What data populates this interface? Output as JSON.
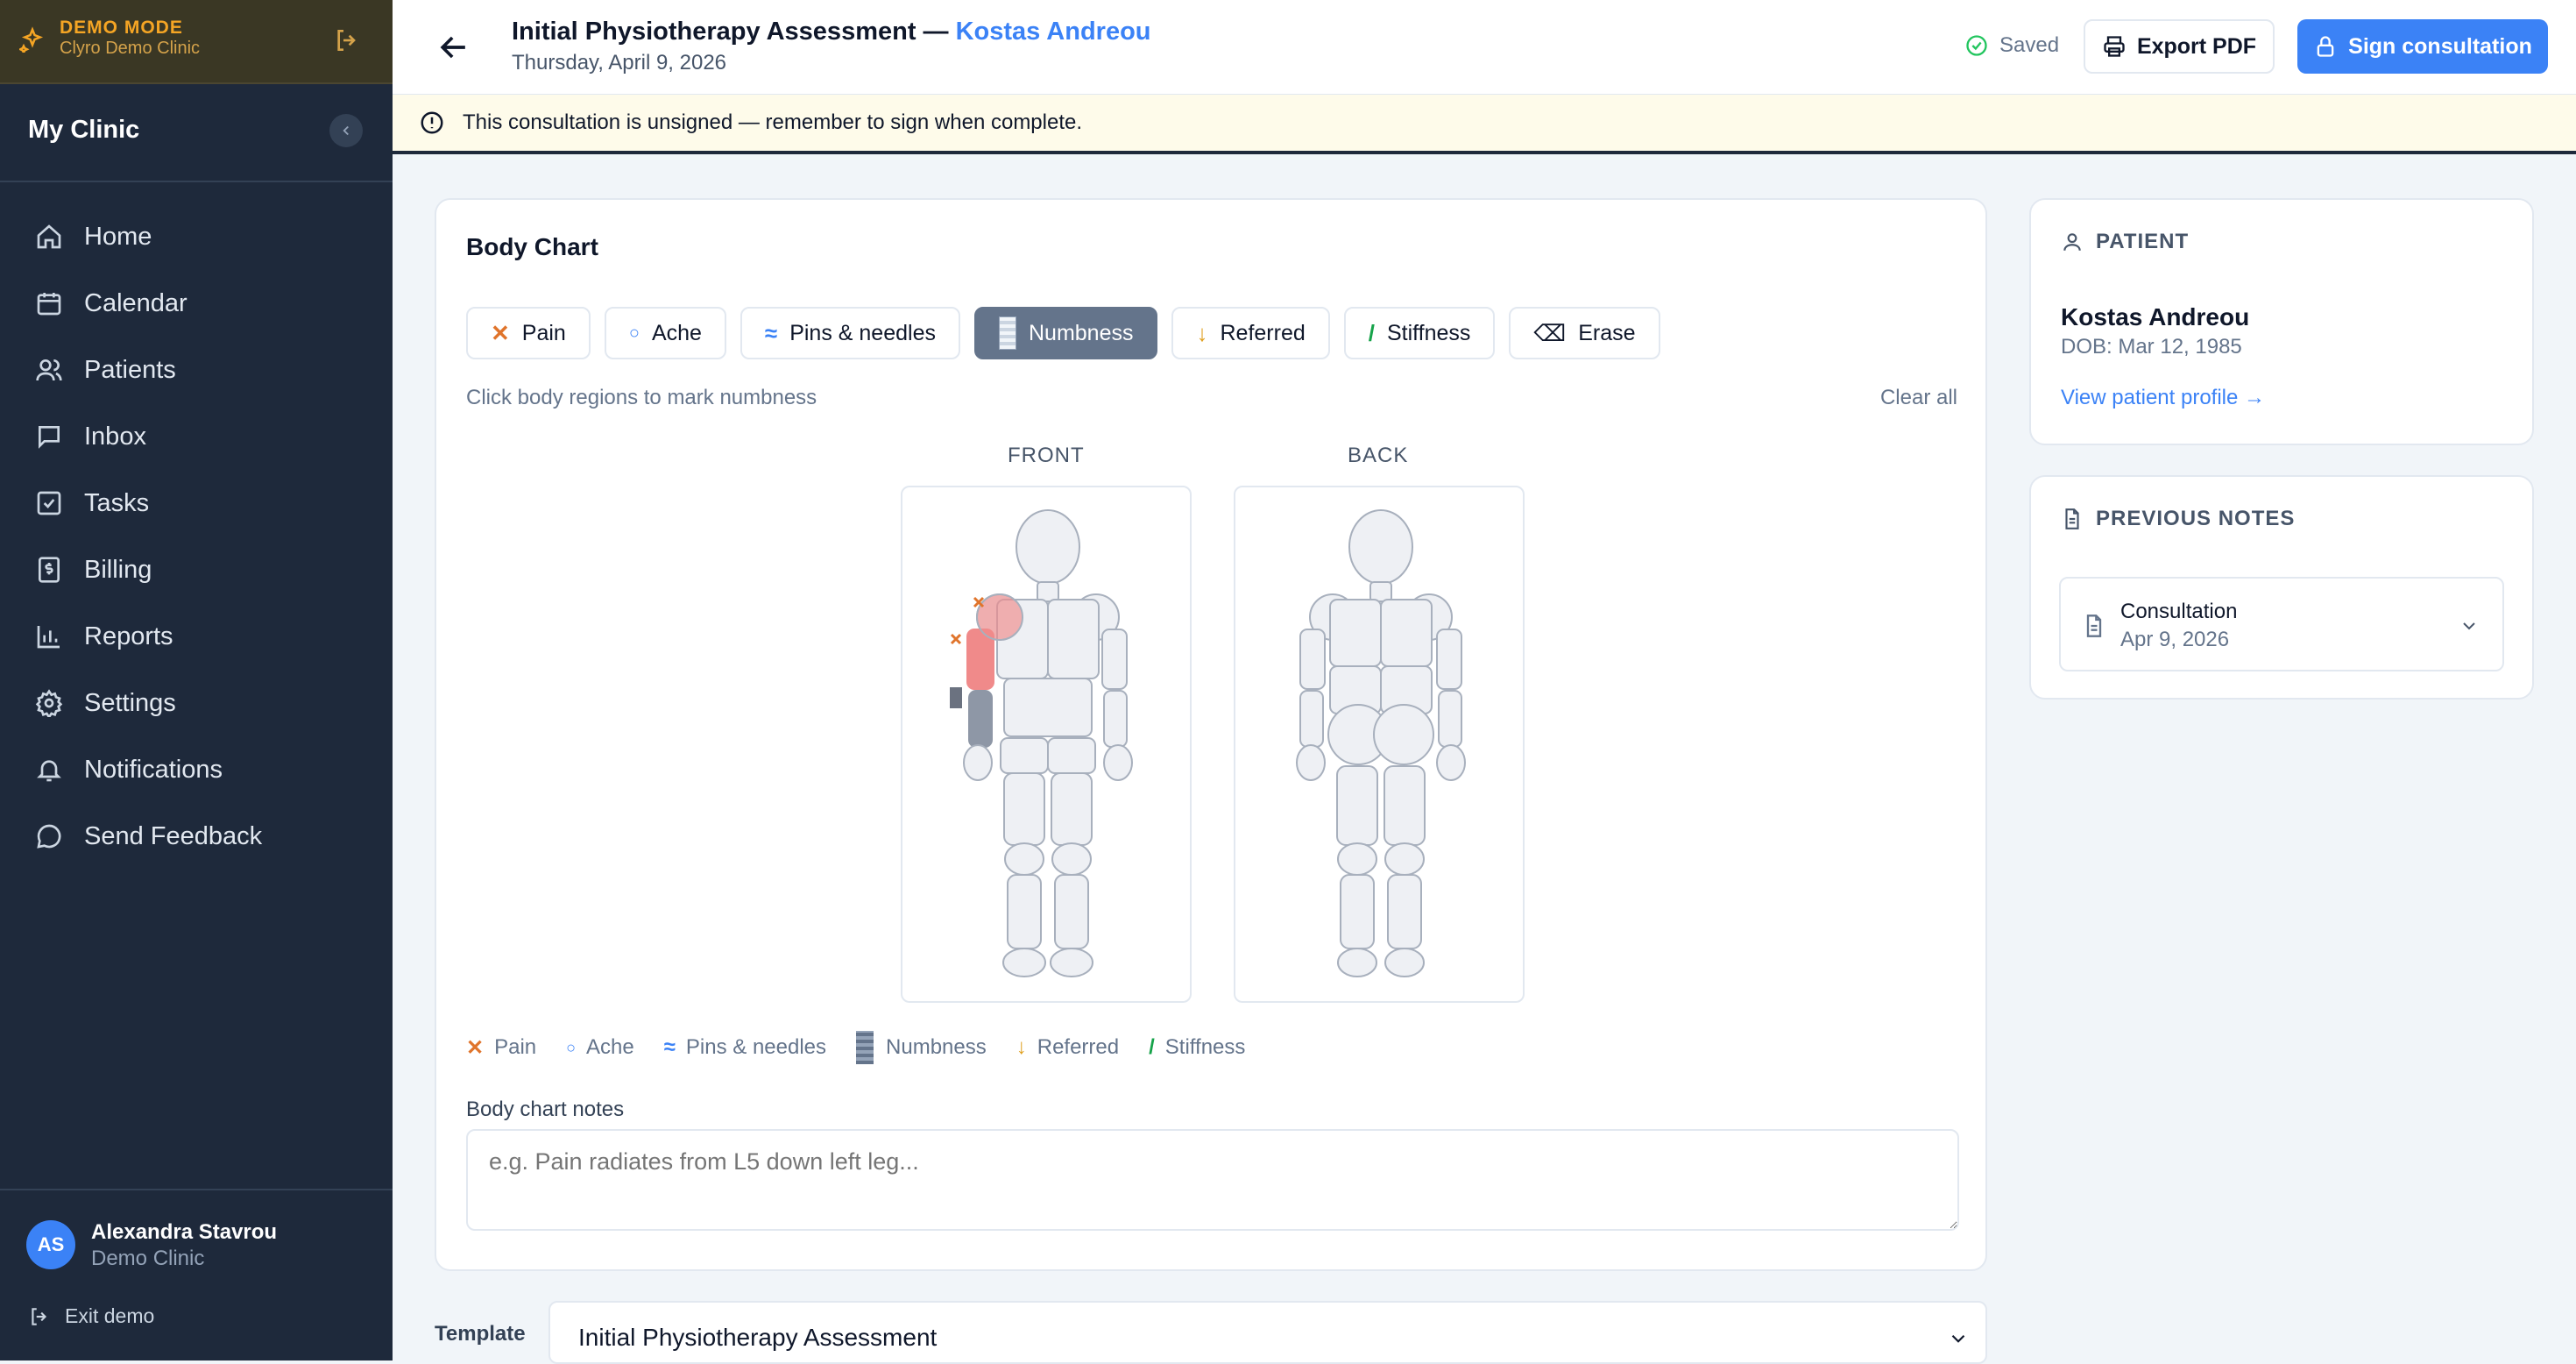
{
  "demo": {
    "mode_label": "DEMO MODE",
    "clinic": "Clyro Demo Clinic"
  },
  "sidebar": {
    "clinic_name": "My Clinic",
    "items": [
      {
        "label": "Home",
        "icon": "home-icon"
      },
      {
        "label": "Calendar",
        "icon": "calendar-icon"
      },
      {
        "label": "Patients",
        "icon": "users-icon"
      },
      {
        "label": "Inbox",
        "icon": "message-icon"
      },
      {
        "label": "Tasks",
        "icon": "check-square-icon"
      },
      {
        "label": "Billing",
        "icon": "dollar-file-icon"
      },
      {
        "label": "Reports",
        "icon": "bar-chart-icon"
      },
      {
        "label": "Settings",
        "icon": "gear-icon"
      },
      {
        "label": "Notifications",
        "icon": "bell-icon"
      },
      {
        "label": "Send Feedback",
        "icon": "chat-bubble-icon"
      }
    ],
    "user": {
      "initials": "AS",
      "name": "Alexandra Stavrou",
      "clinic": "Demo Clinic"
    },
    "exit_label": "Exit demo"
  },
  "header": {
    "title": "Initial Physiotherapy Assessment —",
    "patient_name": "Kostas Andreou",
    "date": "Thursday, April 9, 2026",
    "saved_label": "Saved",
    "export_label": "Export PDF",
    "sign_label": "Sign consultation"
  },
  "banner": {
    "text": "This consultation is unsigned — remember to sign when complete."
  },
  "body_chart": {
    "title": "Body Chart",
    "tools": [
      {
        "label": "Pain",
        "glyph": "✕",
        "color": "#e0742b"
      },
      {
        "label": "Ache",
        "glyph": "○",
        "color": "#3b82f6"
      },
      {
        "label": "Pins & needles",
        "glyph": "≈",
        "color": "#3b82f6"
      },
      {
        "label": "Numbness",
        "glyph": "",
        "color": "#64748b",
        "active": true
      },
      {
        "label": "Referred",
        "glyph": "↓",
        "color": "#e0a020"
      },
      {
        "label": "Stiffness",
        "glyph": "/",
        "color": "#16a34a"
      },
      {
        "label": "Erase",
        "glyph": "⌫",
        "color": "#0f172a"
      }
    ],
    "hint": "Click body regions to mark numbness",
    "clear_label": "Clear all",
    "front_label": "FRONT",
    "back_label": "BACK",
    "legend": [
      {
        "label": "Pain",
        "glyph": "✕",
        "color": "#e0742b"
      },
      {
        "label": "Ache",
        "glyph": "○",
        "color": "#3b82f6"
      },
      {
        "label": "Pins & needles",
        "glyph": "≈",
        "color": "#3b82f6"
      },
      {
        "label": "Numbness",
        "glyph": "",
        "color": "#64748b"
      },
      {
        "label": "Referred",
        "glyph": "↓",
        "color": "#e0a020"
      },
      {
        "label": "Stiffness",
        "glyph": "/",
        "color": "#16a34a"
      }
    ],
    "notes_label": "Body chart notes",
    "notes_placeholder": "e.g. Pain radiates from L5 down left leg..."
  },
  "template": {
    "label": "Template",
    "value": "Initial Physiotherapy Assessment"
  },
  "patient": {
    "section_label": "PATIENT",
    "name": "Kostas Andreou",
    "dob": "DOB: Mar 12, 1985",
    "link": "View patient profile →"
  },
  "previous_notes": {
    "section_label": "PREVIOUS NOTES",
    "items": [
      {
        "title": "Consultation",
        "date": "Apr 9, 2026"
      }
    ]
  }
}
